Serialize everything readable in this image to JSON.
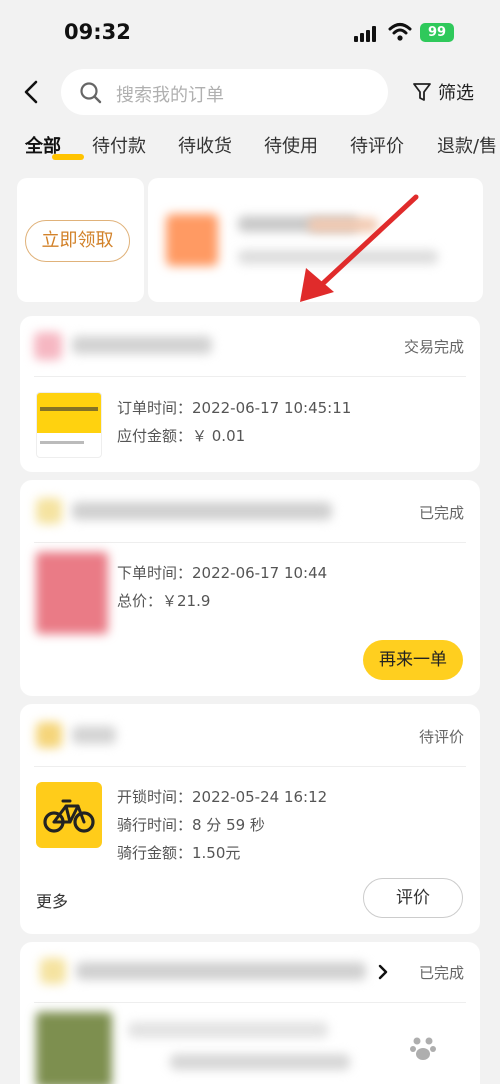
{
  "status_bar": {
    "time": "09:32",
    "battery": "99"
  },
  "search": {
    "placeholder": "搜索我的订单",
    "filter_label": "筛选"
  },
  "tabs": [
    {
      "label": "全部",
      "active": true
    },
    {
      "label": "待付款"
    },
    {
      "label": "待收货"
    },
    {
      "label": "待使用"
    },
    {
      "label": "待评价"
    },
    {
      "label": "退款/售"
    }
  ],
  "coupon": {
    "claim_label": "立即领取"
  },
  "orders": [
    {
      "status": "交易完成",
      "lines": [
        "订单时间：2022-06-17 10:45:11",
        "应付金额：￥ 0.01"
      ]
    },
    {
      "status": "已完成",
      "lines": [
        "下单时间：2022-06-17 10:44",
        "总价：￥21.9"
      ],
      "action_label": "再来一单"
    },
    {
      "status": "待评价",
      "lines": [
        "开锁时间：2022-05-24 16:12",
        "骑行时间：8 分 59 秒",
        "骑行金额：1.50元"
      ],
      "more_label": "更多",
      "action_label": "评价"
    },
    {
      "status": "已完成"
    }
  ],
  "colors": {
    "accent_yellow": "#ffcf1f",
    "claim_orange": "#d2822a",
    "arrow_red": "#e02b2b",
    "battery_green": "#2fc95b"
  }
}
